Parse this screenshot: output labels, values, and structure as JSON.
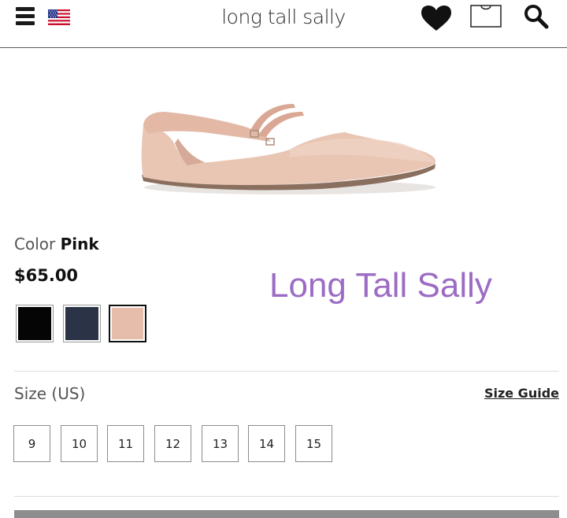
{
  "header": {
    "logo_text": "long tall sally"
  },
  "product": {
    "color_label": "Color",
    "color_value": "Pink",
    "price": "$65.00",
    "brand_overlay": "Long Tall Sally",
    "swatches": [
      {
        "name": "black",
        "color": "#050505"
      },
      {
        "name": "navy",
        "color": "#2b3447"
      },
      {
        "name": "pink",
        "color": "#e6bdab",
        "selected": true
      }
    ]
  },
  "sizes": {
    "label": "Size (US)",
    "guide_label": "Size Guide",
    "options": [
      "9",
      "10",
      "11",
      "12",
      "13",
      "14",
      "15"
    ]
  }
}
